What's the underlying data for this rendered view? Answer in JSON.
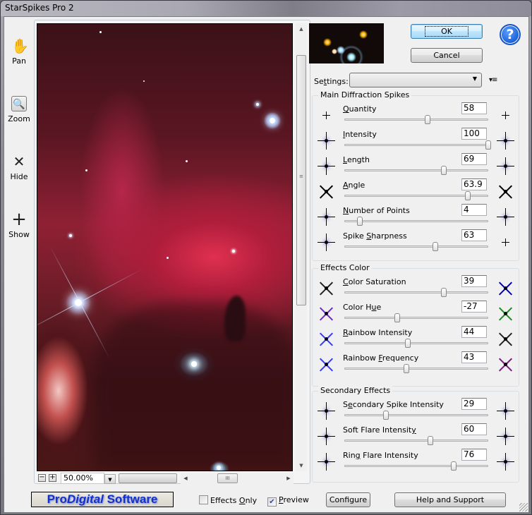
{
  "window": {
    "title": "StarSpikes Pro 2"
  },
  "tools": [
    {
      "label": "Pan",
      "icon": "hand-icon"
    },
    {
      "label": "Zoom",
      "icon": "magnifier-icon",
      "selected": true
    },
    {
      "label": "Hide",
      "icon": "x-icon"
    },
    {
      "label": "Show",
      "icon": "plus-icon"
    }
  ],
  "view": {
    "zoom_minus": "−",
    "zoom_plus": "+",
    "zoom_level": "50.00%",
    "scroll_grip": "III"
  },
  "buttons": {
    "ok": "OK",
    "cancel": "Cancel",
    "configure": "Configure",
    "help_support": "Help and Support",
    "help_icon": "?"
  },
  "settings": {
    "label": "Settings:",
    "value": ""
  },
  "groups": {
    "main": {
      "title": "Main Diffraction Spikes",
      "rows": [
        {
          "label": "Quantity",
          "value": "58",
          "pos": 0.58
        },
        {
          "label": "Intensity",
          "value": "100",
          "pos": 1.0
        },
        {
          "label": "Length",
          "value": "69",
          "pos": 0.69
        },
        {
          "label": "Angle",
          "value": "63.9",
          "pos": 0.86
        },
        {
          "label": "Number of Points",
          "value": "4",
          "pos": 0.11
        },
        {
          "label": "Spike Sharpness",
          "value": "63",
          "pos": 0.63
        }
      ]
    },
    "color": {
      "title": "Effects Color",
      "rows": [
        {
          "label": "Color Saturation",
          "value": "39",
          "pos": 0.69
        },
        {
          "label": "Color Hue",
          "value": "-27",
          "pos": 0.37
        },
        {
          "label": "Rainbow Intensity",
          "value": "44",
          "pos": 0.44
        },
        {
          "label": "Rainbow Frequency",
          "value": "43",
          "pos": 0.43
        }
      ]
    },
    "secondary": {
      "title": "Secondary Effects",
      "rows": [
        {
          "label": "Secondary Spike Intensity",
          "value": "29",
          "pos": 0.29
        },
        {
          "label": "Soft Flare Intensity",
          "value": "60",
          "pos": 0.6
        },
        {
          "label": "Ring Flare Intensity",
          "value": "76",
          "pos": 0.76
        }
      ]
    }
  },
  "footer": {
    "logo_pre": "Pro",
    "logo_italic": "Digital",
    "logo_post": " Software",
    "effects_only_label": "Effects Only",
    "effects_only_checked": false,
    "preview_label": "Preview",
    "preview_checked": true
  }
}
